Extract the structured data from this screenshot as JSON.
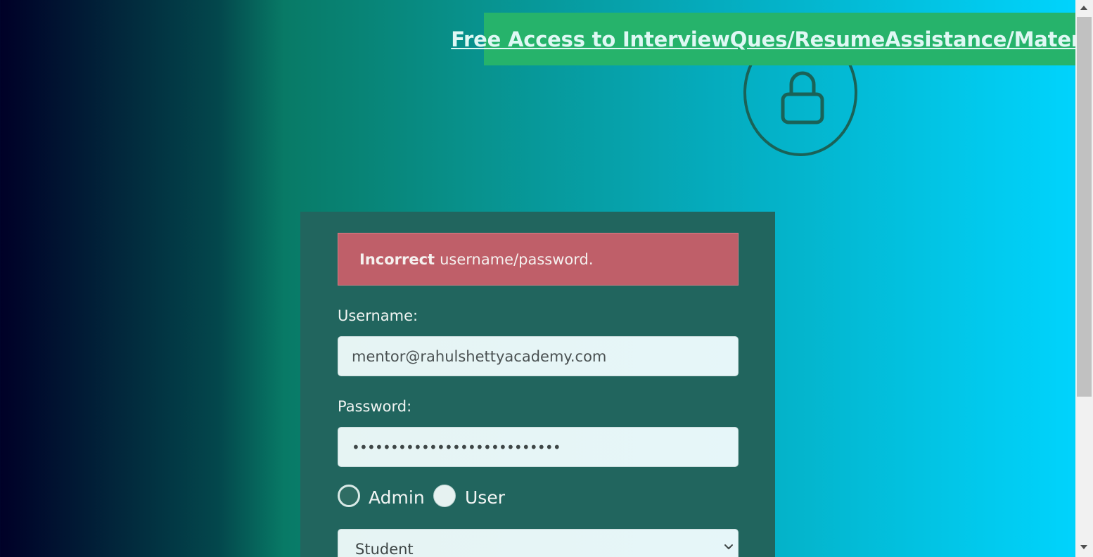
{
  "banner": {
    "link_text": "Free Access to InterviewQues/ResumeAssistance/Material",
    "background": "#26b36b"
  },
  "lock": {
    "icon": "lock-icon"
  },
  "alert": {
    "strong": "Incorrect",
    "message": "username/password.",
    "background": "#bf5f69"
  },
  "username": {
    "label": "Username:",
    "value": "mentor@rahulshettyacademy.com"
  },
  "password": {
    "label": "Password:",
    "masked_value": "•••••••••••••••••••••••••••"
  },
  "role": {
    "options": [
      {
        "label": "Admin",
        "selected": true
      },
      {
        "label": "User",
        "selected": false
      }
    ]
  },
  "user_type": {
    "selected": "Student",
    "icon": "chevron-down-icon"
  },
  "colors": {
    "panel": "#21655e",
    "accent": "#00d3fc"
  }
}
